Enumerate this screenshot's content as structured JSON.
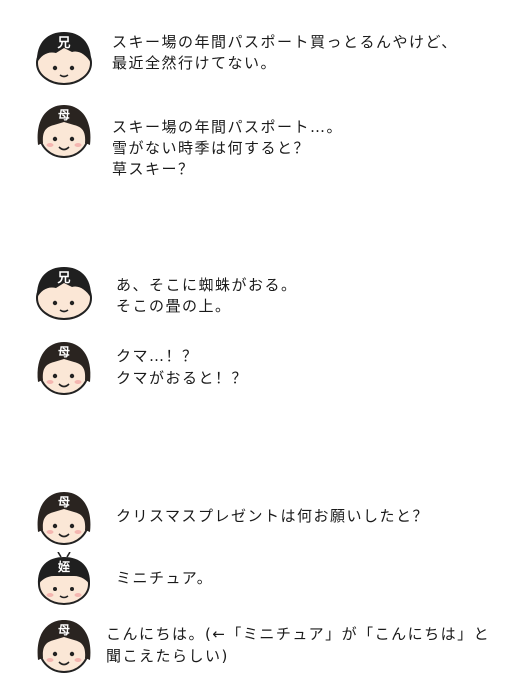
{
  "conversation": [
    {
      "speaker": "兄",
      "lines": [
        "スキー場の年間パスポート買っとるんやけど、",
        "最近全然行けてない。"
      ]
    },
    {
      "speaker": "母",
      "lines": [
        "スキー場の年間パスポート…。",
        "雪がない時季は何すると？",
        "草スキー？"
      ]
    },
    {
      "speaker": "兄",
      "lines": [
        "あ、そこに蜘蛛がおる。",
        "そこの畳の上。"
      ]
    },
    {
      "speaker": "母",
      "lines": [
        "クマ…！？",
        "クマがおると！？"
      ]
    },
    {
      "speaker": "母",
      "lines": [
        "クリスマスプレゼントは何お願いしたと？"
      ]
    },
    {
      "speaker": "姪",
      "lines": [
        "ミニチュア。"
      ]
    },
    {
      "speaker": "母",
      "lines": [
        "こんにちは。(←「ミニチュア」が「こんにちは」と",
        "聞こえたらしい)"
      ]
    }
  ]
}
